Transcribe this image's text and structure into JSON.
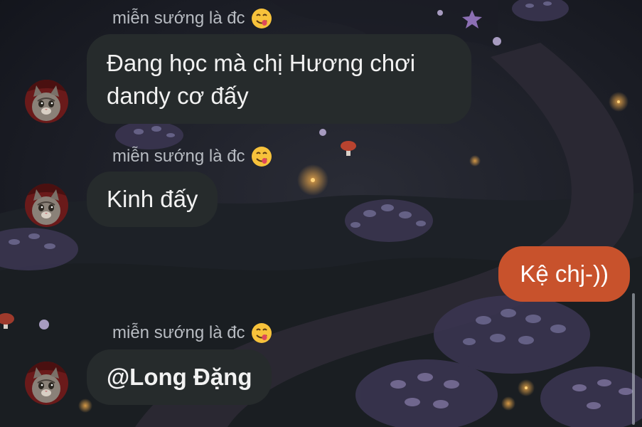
{
  "colors": {
    "incoming_bubble": "#262b2c",
    "outgoing_bubble": "#c8522c",
    "sender_name": "#b8bcc2"
  },
  "messages": [
    {
      "sender": "miễn sướng là đc",
      "sender_emoji": "savoring-face-emoji",
      "text": "Đang học mà chị Hương chơi dandy cơ đấy",
      "direction": "incoming"
    },
    {
      "sender": "miễn sướng là đc",
      "sender_emoji": "savoring-face-emoji",
      "text": "Kinh đấy",
      "direction": "incoming"
    },
    {
      "text": "Kệ chj-))",
      "direction": "outgoing"
    },
    {
      "sender": "miễn sướng là đc",
      "sender_emoji": "savoring-face-emoji",
      "text": "@Long Đặng",
      "direction": "incoming"
    }
  ]
}
